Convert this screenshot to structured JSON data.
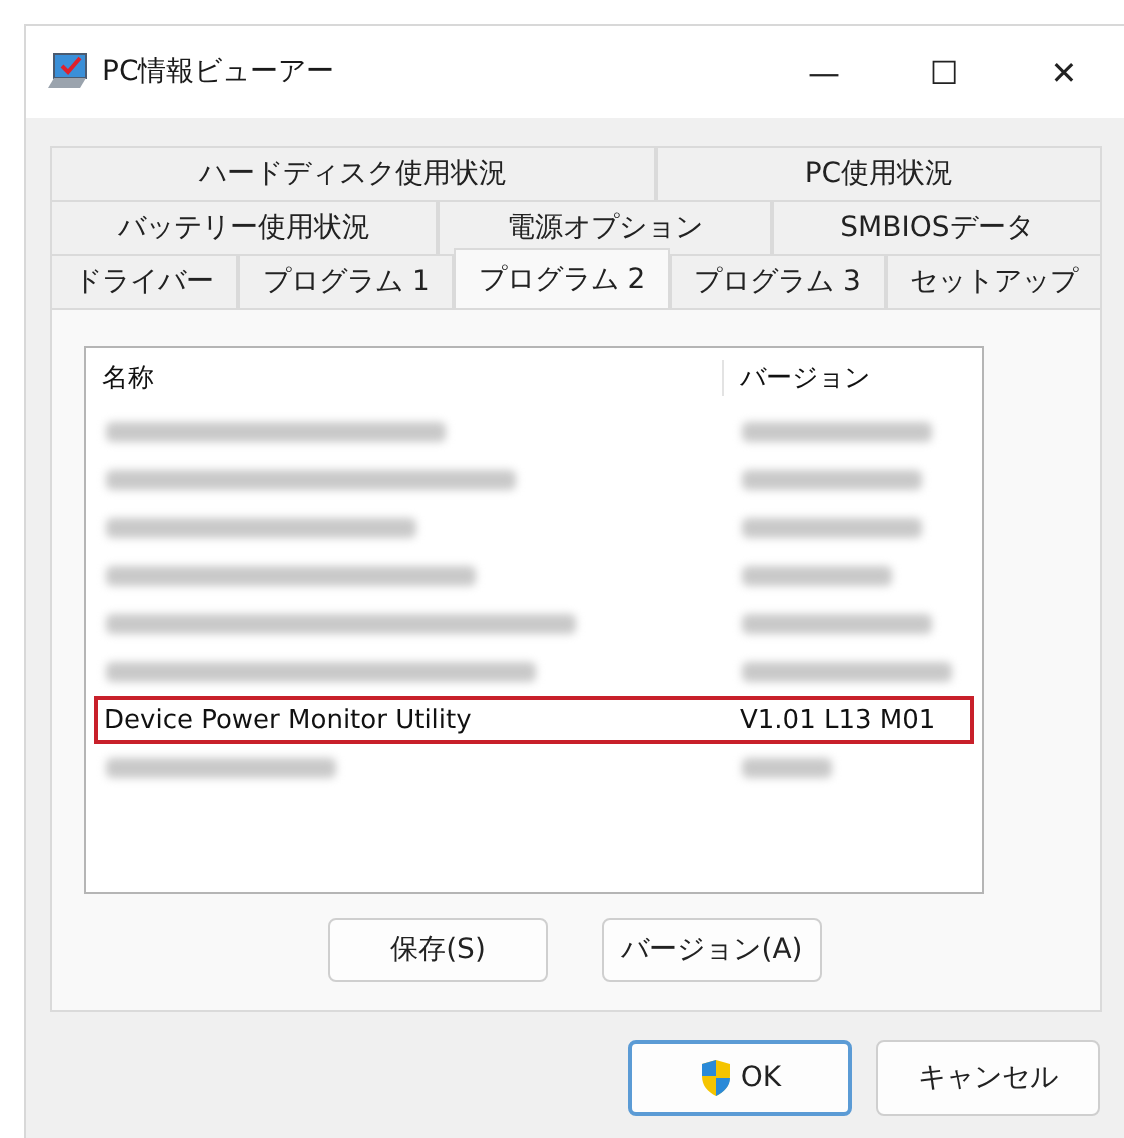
{
  "window": {
    "title": "PC情報ビューアー",
    "controls": [
      "—",
      "☐",
      "✕"
    ]
  },
  "tab_rows": [
    {
      "tabs": [
        {
          "label": "ハードディスク使用状況",
          "selected": false
        },
        {
          "label": "PC使用状況",
          "selected": false
        }
      ]
    },
    {
      "tabs": [
        {
          "label": "バッテリー使用状況",
          "selected": false
        },
        {
          "label": "電源オプション",
          "selected": false
        },
        {
          "label": "SMBIOSデータ",
          "selected": false
        }
      ]
    },
    {
      "tabs": [
        {
          "label": "ドライバー",
          "selected": false
        },
        {
          "label": "プログラム 1",
          "selected": false
        },
        {
          "label": "プログラム 2",
          "selected": true
        },
        {
          "label": "プログラム 3",
          "selected": false
        },
        {
          "label": "セットアップ",
          "selected": false
        }
      ]
    }
  ],
  "table": {
    "columns": [
      "名称",
      "バージョン"
    ],
    "rows": [
      {
        "redacted": true,
        "highlighted": false
      },
      {
        "redacted": true,
        "highlighted": false
      },
      {
        "redacted": true,
        "highlighted": false
      },
      {
        "redacted": true,
        "highlighted": false
      },
      {
        "redacted": true,
        "highlighted": false
      },
      {
        "redacted": true,
        "highlighted": false
      },
      {
        "redacted": false,
        "highlighted": true,
        "name": "Device Power Monitor Utility",
        "version": "V1.01 L13 M01"
      },
      {
        "redacted": true,
        "highlighted": false
      }
    ]
  },
  "panel_buttons": [
    "保存(S)",
    "バージョン(A)"
  ],
  "dialog_buttons": [
    {
      "label": "OK",
      "default": true,
      "shield": true
    },
    {
      "label": "キャンセル",
      "default": false,
      "shield": false
    }
  ]
}
